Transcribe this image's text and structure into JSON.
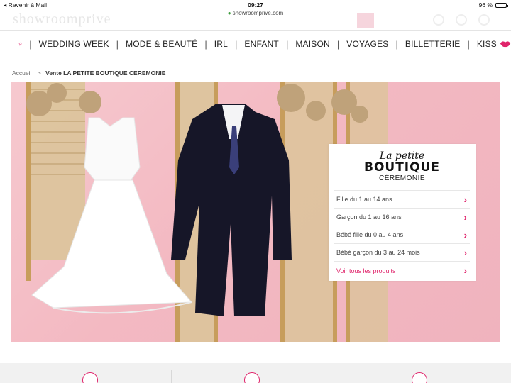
{
  "statusbar": {
    "back": "◂ Revenir à Mail",
    "time": "09:27",
    "battery": "96 %",
    "battery_level": 0.96
  },
  "browser": {
    "url": "showroomprive.com",
    "ghost_logo": "showroomprive"
  },
  "nav": {
    "items": [
      "WEDDING WEEK",
      "MODE & BEAUTÉ",
      "IRL",
      "ENFANT",
      "MAISON",
      "VOYAGES",
      "BILLETTERIE",
      "KISS"
    ],
    "separator": "|"
  },
  "breadcrumb": {
    "home": "Accueil",
    "current": "Vente LA PETITE BOUTIQUE CEREMONIE",
    "sep": ">"
  },
  "panel": {
    "brand_line1": "La petite",
    "brand_line2": "BOUTIQUE",
    "brand_line3": "CÉRÉMONIE",
    "items": [
      "Fille du 1 au 14 ans",
      "Garçon du 1 au 16 ans",
      "Bébé fille du 0 au 4 ans",
      "Bébé garçon du 3 au 24 mois"
    ],
    "all_products": "Voir tous les produits",
    "chevron": "›"
  },
  "colors": {
    "accent": "#e0246b",
    "hero_bg": "#f3b9c2"
  },
  "icons": [
    "home-icon",
    "lips-icon",
    "chevron-right-icon",
    "lock-icon"
  ]
}
